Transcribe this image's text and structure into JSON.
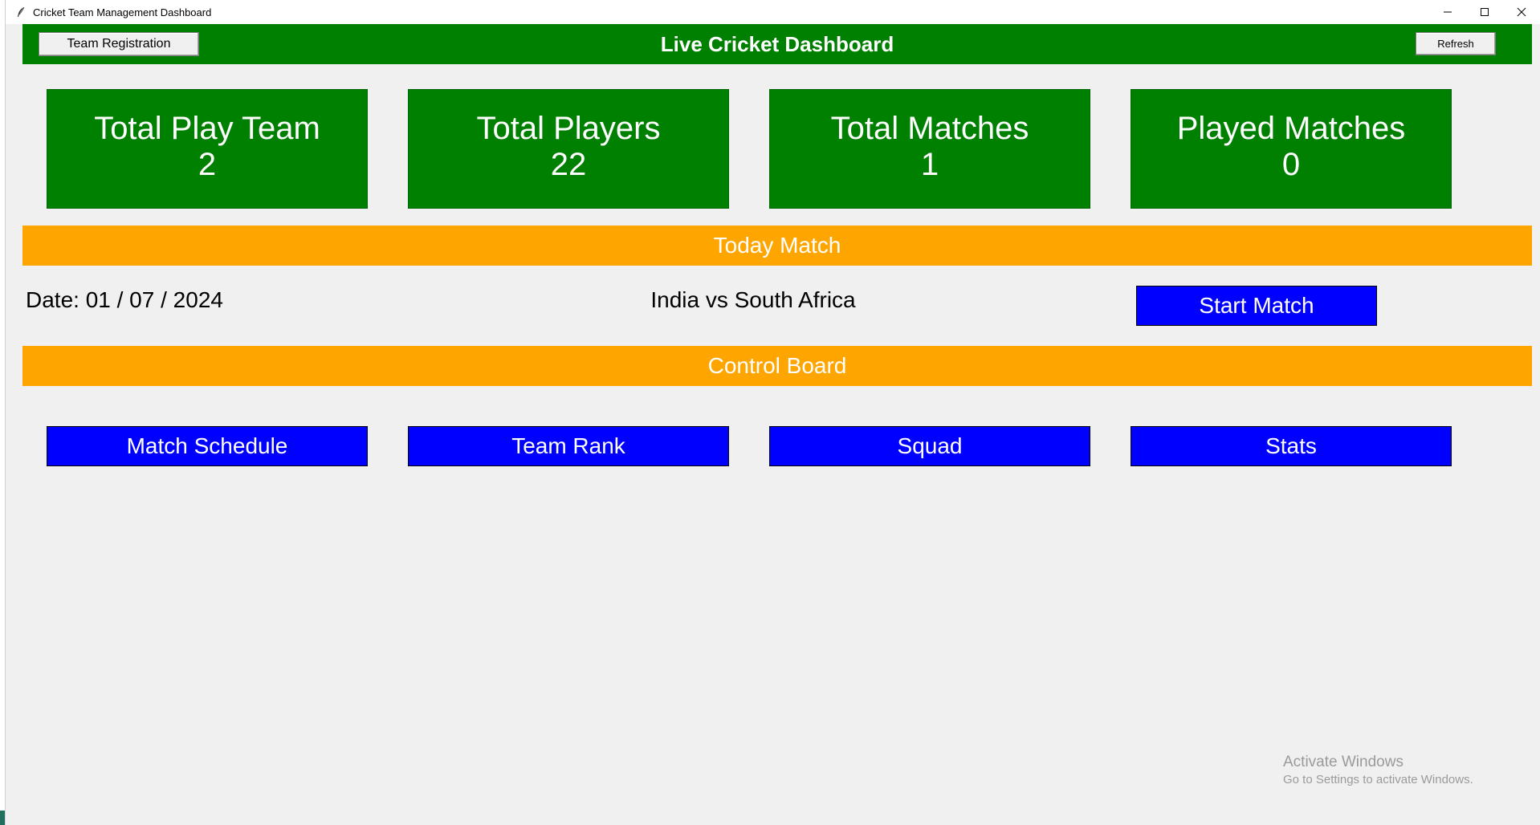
{
  "window": {
    "title": "Cricket Team Management Dashboard",
    "controls": [
      "minimize-icon",
      "maximize-icon",
      "close-icon"
    ]
  },
  "header": {
    "title": "Live Cricket Dashboard",
    "team_registration_label": "Team Registration",
    "refresh_label": "Refresh",
    "background_color": "#008000"
  },
  "stats": [
    {
      "label": "Total Play Team",
      "value": "2"
    },
    {
      "label": "Total Players",
      "value": "22"
    },
    {
      "label": "Total Matches",
      "value": "1"
    },
    {
      "label": "Played Matches",
      "value": "0"
    }
  ],
  "today_match": {
    "banner": "Today Match",
    "date": "Date: 01 / 07 / 2024",
    "teams": "India vs South Africa",
    "start_label": "Start Match"
  },
  "control_board": {
    "banner": "Control Board",
    "buttons": [
      "Match Schedule",
      "Team Rank",
      "Squad",
      "Stats"
    ]
  },
  "watermark": {
    "title": "Activate Windows",
    "subtitle": "Go to Settings to activate Windows."
  },
  "colors": {
    "green": "#008000",
    "orange": "#ffa500",
    "blue": "#0000ff"
  }
}
